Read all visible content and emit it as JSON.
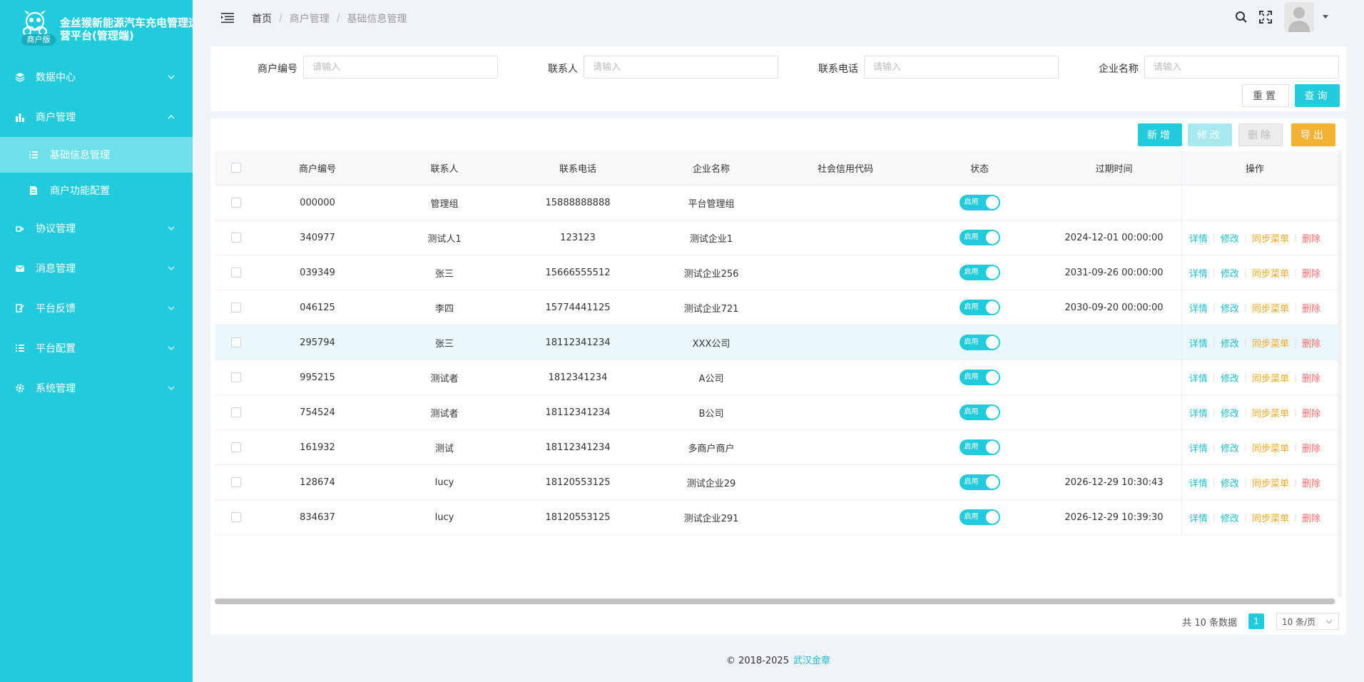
{
  "app": {
    "title": "金丝猴新能源汽车充电管理运营平台(管理端)",
    "badge": "商户版"
  },
  "sidebar": {
    "items": [
      {
        "label": "数据中心",
        "icon": "layers-icon"
      },
      {
        "label": "商户管理",
        "icon": "bar-chart-icon"
      },
      {
        "label": "协议管理",
        "icon": "plug-icon"
      },
      {
        "label": "消息管理",
        "icon": "mail-icon"
      },
      {
        "label": "平台反馈",
        "icon": "edit-icon"
      },
      {
        "label": "平台配置",
        "icon": "list-icon"
      },
      {
        "label": "系统管理",
        "icon": "gear-icon"
      }
    ],
    "sub": [
      {
        "label": "基础信息管理",
        "icon": "list-icon"
      },
      {
        "label": "商户功能配置",
        "icon": "doc-icon"
      }
    ]
  },
  "header": {
    "breadcrumb": [
      "首页",
      "商户管理",
      "基础信息管理"
    ]
  },
  "search": {
    "fields": [
      {
        "label": "商户编号",
        "placeholder": "请输入"
      },
      {
        "label": "联系人",
        "placeholder": "请输入"
      },
      {
        "label": "联系电话",
        "placeholder": "请输入"
      },
      {
        "label": "企业名称",
        "placeholder": "请输入"
      }
    ],
    "reset_label": "重置",
    "query_label": "查询"
  },
  "toolbar": {
    "add_label": "新增",
    "edit_label": "修改",
    "delete_label": "删除",
    "export_label": "导出"
  },
  "table": {
    "headers": [
      "商户编号",
      "联系人",
      "联系电话",
      "企业名称",
      "社会信用代码",
      "状态",
      "过期时间",
      "操作"
    ],
    "switch_label": "启用",
    "actions": [
      "详情",
      "修改",
      "同步菜单",
      "删除"
    ],
    "rows": [
      {
        "no": "000000",
        "name": "管理组",
        "phone": "15888888888",
        "corp": "平台管理组",
        "code": "",
        "expire": "",
        "ops": false
      },
      {
        "no": "340977",
        "name": "测试人1",
        "phone": "123123",
        "corp": "测试企业1",
        "code": "",
        "expire": "2024-12-01 00:00:00",
        "ops": true
      },
      {
        "no": "039349",
        "name": "张三",
        "phone": "15666555512",
        "corp": "测试企业256",
        "code": "",
        "expire": "2031-09-26 00:00:00",
        "ops": true
      },
      {
        "no": "046125",
        "name": "李四",
        "phone": "15774441125",
        "corp": "测试企业721",
        "code": "",
        "expire": "2030-09-20 00:00:00",
        "ops": true
      },
      {
        "no": "295794",
        "name": "张三",
        "phone": "18112341234",
        "corp": "XXX公司",
        "code": "",
        "expire": "",
        "ops": true
      },
      {
        "no": "995215",
        "name": "测试者",
        "phone": "1812341234",
        "corp": "A公司",
        "code": "",
        "expire": "",
        "ops": true
      },
      {
        "no": "754524",
        "name": "测试者",
        "phone": "18112341234",
        "corp": "B公司",
        "code": "",
        "expire": "",
        "ops": true
      },
      {
        "no": "161932",
        "name": "测试",
        "phone": "18112341234",
        "corp": "多商户商户",
        "code": "",
        "expire": "",
        "ops": true
      },
      {
        "no": "128674",
        "name": "lucy",
        "phone": "18120553125",
        "corp": "测试企业29",
        "code": "",
        "expire": "2026-12-29 10:30:43",
        "ops": true
      },
      {
        "no": "834637",
        "name": "lucy",
        "phone": "18120553125",
        "corp": "测试企业291",
        "code": "",
        "expire": "2026-12-29 10:39:30",
        "ops": true
      }
    ]
  },
  "pagination": {
    "total_text": "共 10 条数据",
    "current_page": "1",
    "page_size": "10 条/页"
  },
  "footer": {
    "copyright": "© 2018-2025",
    "company": "武汉金章"
  },
  "colors": {
    "accent": "#22cbdb",
    "warning": "#f2b233",
    "danger": "#f56c6c"
  }
}
